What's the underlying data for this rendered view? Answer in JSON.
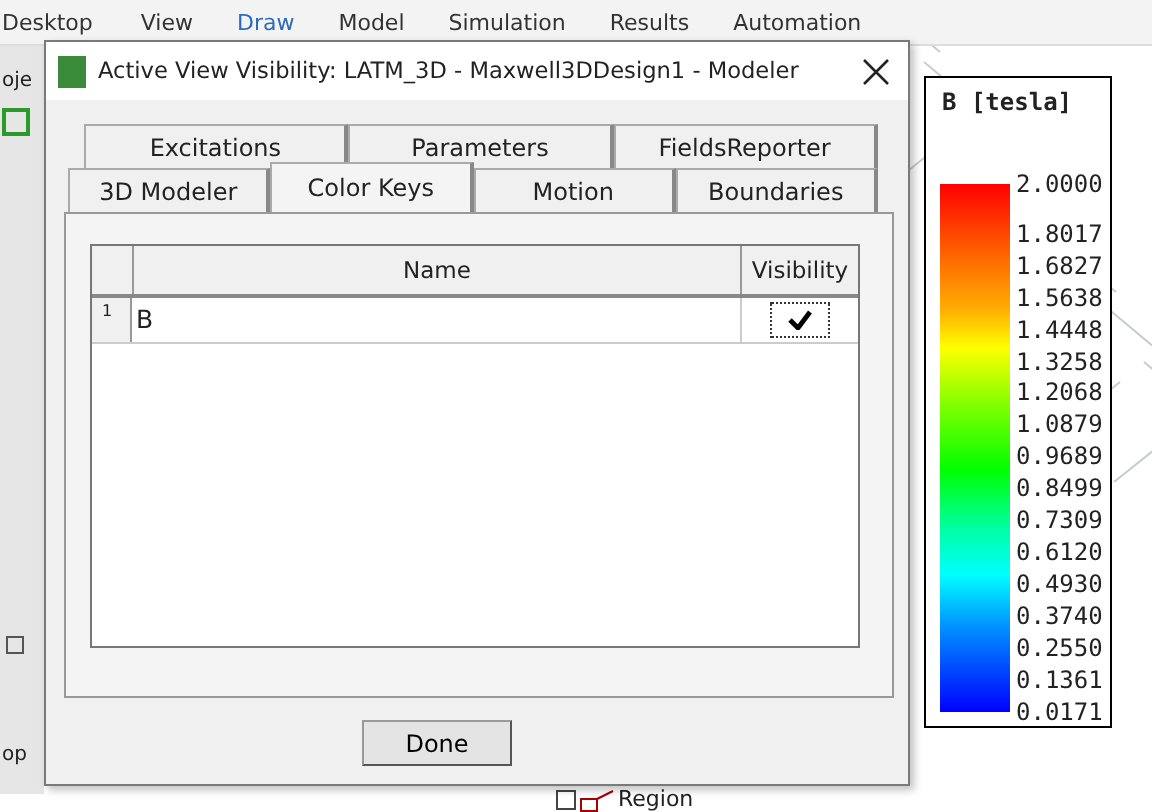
{
  "ribbon": {
    "tabs": [
      {
        "label": "Desktop",
        "selected": false
      },
      {
        "label": "View",
        "selected": false
      },
      {
        "label": "Draw",
        "selected": true
      },
      {
        "label": "Model",
        "selected": false
      },
      {
        "label": "Simulation",
        "selected": false
      },
      {
        "label": "Results",
        "selected": false
      },
      {
        "label": "Automation",
        "selected": false
      }
    ]
  },
  "left_panel": {
    "top_fragment": "oje",
    "bottom_fragment": "op"
  },
  "tree": {
    "item": "Region"
  },
  "legend": {
    "title": "B [tesla]",
    "labels": [
      "2.0000",
      "1.8017",
      "1.6827",
      "1.5638",
      "1.4448",
      "1.3258",
      "1.2068",
      "1.0879",
      "0.9689",
      "0.8499",
      "0.7309",
      "0.6120",
      "0.4930",
      "0.3740",
      "0.2550",
      "0.1361",
      "0.0171"
    ]
  },
  "dialog": {
    "title": "Active View Visibility: LATM_3D - Maxwell3DDesign1 - Modeler",
    "tab_rows": [
      [
        {
          "label": "Excitations",
          "selected": false
        },
        {
          "label": "Parameters",
          "selected": false
        },
        {
          "label": "FieldsReporter",
          "selected": false
        }
      ],
      [
        {
          "label": "3D Modeler",
          "selected": false
        },
        {
          "label": "Color Keys",
          "selected": true
        },
        {
          "label": "Motion",
          "selected": false
        },
        {
          "label": "Boundaries",
          "selected": false
        }
      ]
    ],
    "grid": {
      "columns": [
        "Name",
        "Visibility"
      ],
      "rows": [
        {
          "number": "1",
          "name": "B",
          "visible": true
        }
      ]
    },
    "buttons": [
      "Done"
    ]
  }
}
